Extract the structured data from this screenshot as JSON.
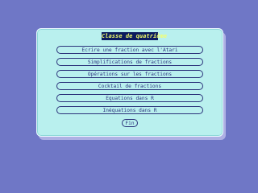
{
  "dialog": {
    "title": "Classe de quatrième",
    "options": [
      "Ecrire une fraction avec l'Atari",
      "Simplifications de fractions",
      "Opérations sur les fractions",
      "Cocktail de fractions",
      "Equations dans R",
      "Inéquations dans R"
    ],
    "exit_label": "Fin"
  },
  "colors": {
    "background": "#6f77c6",
    "panel": "#b9f0ee",
    "title_bg": "#0b1b5e",
    "title_text": "#f5ff6b",
    "text": "#2d347f",
    "border": "#2b327a"
  }
}
